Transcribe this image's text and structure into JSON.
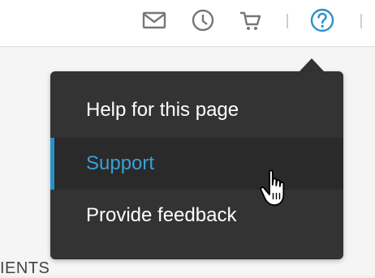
{
  "topbar": {
    "icons": [
      "mail-icon",
      "clock-icon",
      "cart-icon",
      "help-icon"
    ]
  },
  "menu": {
    "items": [
      {
        "label": "Help for this page"
      },
      {
        "label": "Support"
      },
      {
        "label": "Provide feedback"
      }
    ]
  },
  "background": {
    "section_label": "IENTS"
  },
  "colors": {
    "accent": "#2a90c8",
    "menu_bg": "#333333",
    "active_bg": "#2a2a2a",
    "icon": "#777777",
    "help_icon": "#2a90c8"
  }
}
